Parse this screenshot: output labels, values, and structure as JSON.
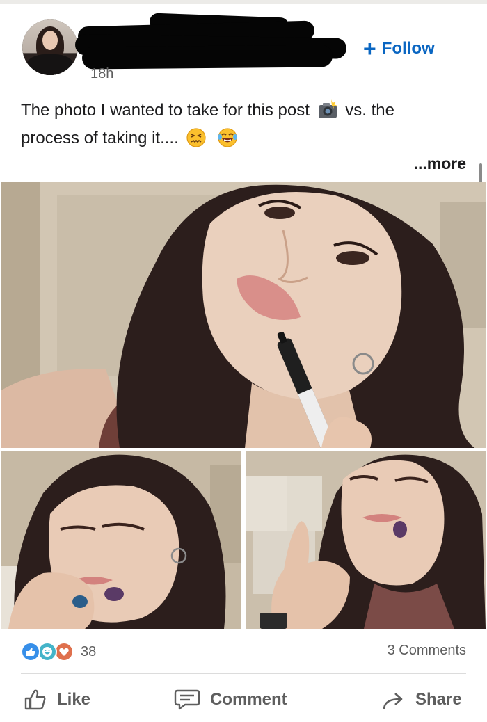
{
  "post": {
    "timestamp": "18h",
    "follow_label": "Follow",
    "follow_plus": "+",
    "caption_line1": "The photo I wanted to take for this post",
    "caption_line1_end": "vs. the",
    "caption_line2": "process of taking it....",
    "more_label": "...more"
  },
  "social": {
    "reaction_count": "38",
    "comments_label": "3 Comments"
  },
  "actions": {
    "like_label": "Like",
    "comment_label": "Comment",
    "share_label": "Share"
  },
  "icons": [
    "camera-flash-emoji",
    "confounded-emoji",
    "laughing-tears-emoji",
    "like-reaction-icon",
    "funny-reaction-icon",
    "love-reaction-icon",
    "thumbs-up-icon",
    "comment-bubble-icon",
    "share-arrow-icon"
  ],
  "colors": {
    "accent": "#0a66c2",
    "text": "#1d1d1f",
    "secondary": "#5e5e5e"
  }
}
